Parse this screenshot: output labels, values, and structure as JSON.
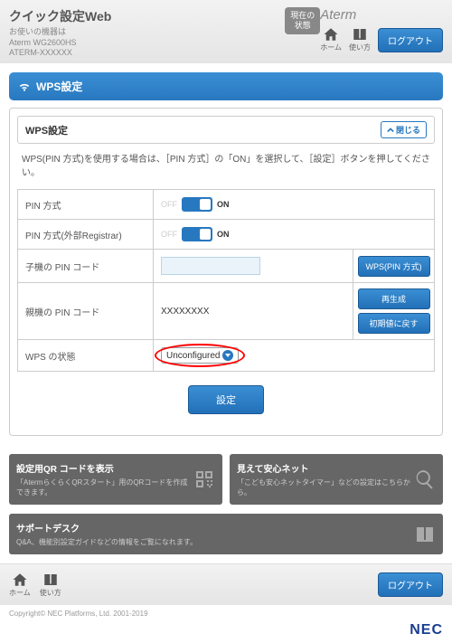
{
  "header": {
    "title": "クイック設定Web",
    "subtitle_line1": "お使いの機器は",
    "subtitle_line2": "Aterm WG2600HS",
    "subtitle_line3": "ATERM-XXXXXX",
    "status_btn_line1": "現在の",
    "status_btn_line2": "状態",
    "brand": "Aterm",
    "nav_home": "ホーム",
    "nav_help": "使い方",
    "logout": "ログアウト"
  },
  "section": {
    "title": "WPS設定",
    "panel_title": "WPS設定",
    "close_label": "閉じる",
    "description": "WPS(PIN 方式)を使用する場合は、［PIN 方式］の「ON」を選択して、［設定］ボタンを押してください。"
  },
  "rows": {
    "pin_method": {
      "label": "PIN 方式",
      "off": "OFF",
      "on": "ON"
    },
    "pin_registrar": {
      "label": "PIN 方式(外部Registrar)",
      "off": "OFF",
      "on": "ON"
    },
    "child_pin": {
      "label": "子機の PIN コード",
      "button": "WPS(PIN 方式)"
    },
    "parent_pin": {
      "label": "親機の PIN コード",
      "value": "XXXXXXXX",
      "regen": "再生成",
      "reset": "初期値に戻す"
    },
    "wps_state": {
      "label": "WPS の状態",
      "value": "Unconfigured"
    }
  },
  "submit": "設定",
  "cards": {
    "qr": {
      "title": "設定用QR コードを表示",
      "desc": "「AtermらくらくQRスタート」用のQRコードを作成できます。"
    },
    "safety": {
      "title": "見えて安心ネット",
      "desc": "「こども安心ネットタイマー」などの設定はこちらから。"
    },
    "support": {
      "title": "サポートデスク",
      "desc": "Q&A、機能別設定ガイドなどの情報をご覧になれます。"
    }
  },
  "footer": {
    "copyright": "Copyright© NEC Platforms, Ltd. 2001-2019",
    "nec": "NEC"
  }
}
